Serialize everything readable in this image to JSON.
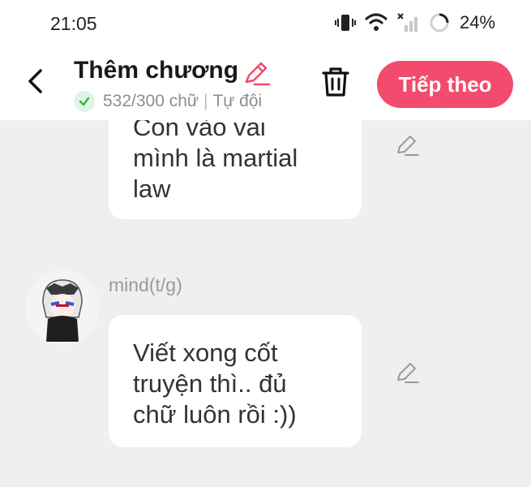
{
  "status_bar": {
    "time": "21:05",
    "battery": "24%",
    "icons": [
      "vibrate-icon",
      "wifi-icon",
      "signal-icon",
      "battery-ring-icon"
    ]
  },
  "header": {
    "title": "Thêm chương",
    "word_count": "532/300 chữ",
    "separator": "|",
    "save_mode": "Tự đội",
    "next_label": "Tiếp theo",
    "accent": "#f24b6d",
    "check_color": "#2fb84f"
  },
  "messages": [
    {
      "lines": [
        "Con vào vai",
        "mình là martial",
        "law"
      ]
    },
    {
      "author": "mind(t/g)",
      "lines": [
        "Viết xong cốt",
        "truyện thì.. đủ",
        "chữ luôn rồi :))"
      ]
    }
  ]
}
